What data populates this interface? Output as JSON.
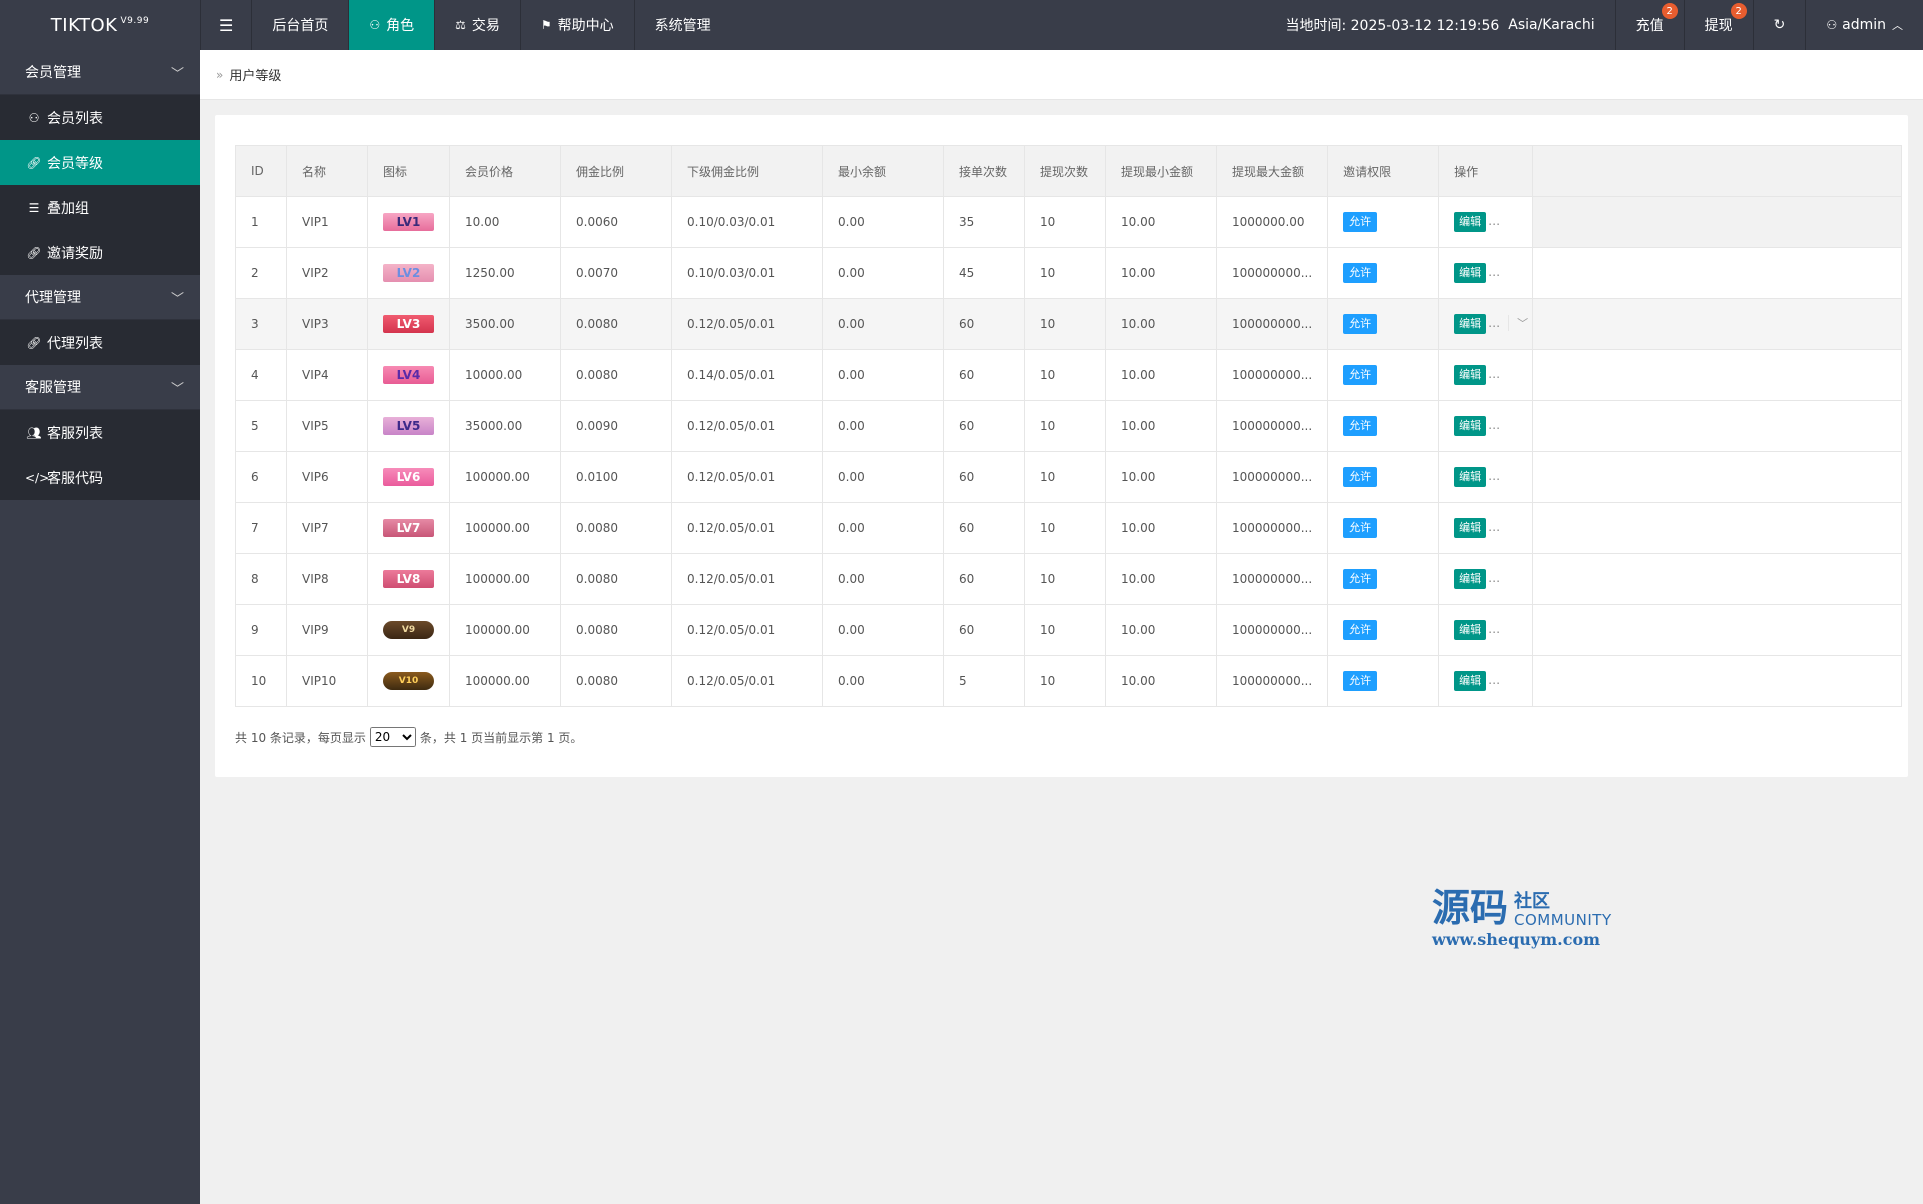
{
  "brand": {
    "name": "TIKTOK",
    "version": "V9.99"
  },
  "topnav": {
    "menu_icon": "menu-icon",
    "items": [
      {
        "label": "后台首页",
        "icon": ""
      },
      {
        "label": "角色",
        "icon": "user-icon",
        "active": true
      },
      {
        "label": "交易",
        "icon": "scale-icon"
      },
      {
        "label": "帮助中心",
        "icon": "flag-icon"
      },
      {
        "label": "系统管理",
        "icon": ""
      }
    ]
  },
  "topright": {
    "time_label": "当地时间: 2025-03-12 12:19:56",
    "timezone": "Asia/Karachi",
    "recharge": {
      "label": "充值",
      "badge": "2"
    },
    "withdraw": {
      "label": "提现",
      "badge": "2"
    },
    "refresh_icon": "refresh-icon",
    "user": {
      "label": "admin"
    }
  },
  "sidebar": {
    "groups": [
      {
        "label": "会员管理",
        "items": [
          {
            "label": "会员列表",
            "icon": "user-icon"
          },
          {
            "label": "会员等级",
            "icon": "link-icon",
            "active": true
          },
          {
            "label": "叠加组",
            "icon": "list-icon"
          },
          {
            "label": "邀请奖励",
            "icon": "link-icon"
          }
        ]
      },
      {
        "label": "代理管理",
        "items": [
          {
            "label": "代理列表",
            "icon": "link-icon"
          }
        ]
      },
      {
        "label": "客服管理",
        "items": [
          {
            "label": "客服列表",
            "icon": "users-icon"
          },
          {
            "label": "客服代码",
            "icon": "code-icon"
          }
        ]
      }
    ]
  },
  "breadcrumb": {
    "current": "用户等级"
  },
  "table": {
    "headers": [
      "ID",
      "名称",
      "图标",
      "会员价格",
      "佣金比例",
      "下级佣金比例",
      "最小余额",
      "接单次数",
      "提现次数",
      "提现最小金额",
      "提现最大金额",
      "邀请权限",
      "操作"
    ],
    "rows": [
      {
        "id": "1",
        "name": "VIP1",
        "icon": "LV1",
        "price": "10.00",
        "rate": "0.0060",
        "sub_rate": "0.10/0.03/0.01",
        "min_balance": "0.00",
        "orders": "35",
        "withdraw_times": "10",
        "wd_min": "10.00",
        "wd_max": "1000000.00",
        "invite": "允许",
        "edit": "编辑"
      },
      {
        "id": "2",
        "name": "VIP2",
        "icon": "LV2",
        "price": "1250.00",
        "rate": "0.0070",
        "sub_rate": "0.10/0.03/0.01",
        "min_balance": "0.00",
        "orders": "45",
        "withdraw_times": "10",
        "wd_min": "10.00",
        "wd_max": "100000000...",
        "invite": "允许",
        "edit": "编辑"
      },
      {
        "id": "3",
        "name": "VIP3",
        "icon": "LV3",
        "price": "3500.00",
        "rate": "0.0080",
        "sub_rate": "0.12/0.05/0.01",
        "min_balance": "0.00",
        "orders": "60",
        "withdraw_times": "10",
        "wd_min": "10.00",
        "wd_max": "100000000...",
        "invite": "允许",
        "edit": "编辑"
      },
      {
        "id": "4",
        "name": "VIP4",
        "icon": "LV4",
        "price": "10000.00",
        "rate": "0.0080",
        "sub_rate": "0.14/0.05/0.01",
        "min_balance": "0.00",
        "orders": "60",
        "withdraw_times": "10",
        "wd_min": "10.00",
        "wd_max": "100000000...",
        "invite": "允许",
        "edit": "编辑"
      },
      {
        "id": "5",
        "name": "VIP5",
        "icon": "LV5",
        "price": "35000.00",
        "rate": "0.0090",
        "sub_rate": "0.12/0.05/0.01",
        "min_balance": "0.00",
        "orders": "60",
        "withdraw_times": "10",
        "wd_min": "10.00",
        "wd_max": "100000000...",
        "invite": "允许",
        "edit": "编辑"
      },
      {
        "id": "6",
        "name": "VIP6",
        "icon": "LV6",
        "price": "100000.00",
        "rate": "0.0100",
        "sub_rate": "0.12/0.05/0.01",
        "min_balance": "0.00",
        "orders": "60",
        "withdraw_times": "10",
        "wd_min": "10.00",
        "wd_max": "100000000...",
        "invite": "允许",
        "edit": "编辑"
      },
      {
        "id": "7",
        "name": "VIP7",
        "icon": "LV7",
        "price": "100000.00",
        "rate": "0.0080",
        "sub_rate": "0.12/0.05/0.01",
        "min_balance": "0.00",
        "orders": "60",
        "withdraw_times": "10",
        "wd_min": "10.00",
        "wd_max": "100000000...",
        "invite": "允许",
        "edit": "编辑"
      },
      {
        "id": "8",
        "name": "VIP8",
        "icon": "LV8",
        "price": "100000.00",
        "rate": "0.0080",
        "sub_rate": "0.12/0.05/0.01",
        "min_balance": "0.00",
        "orders": "60",
        "withdraw_times": "10",
        "wd_min": "10.00",
        "wd_max": "100000000...",
        "invite": "允许",
        "edit": "编辑"
      },
      {
        "id": "9",
        "name": "VIP9",
        "icon": "V9",
        "price": "100000.00",
        "rate": "0.0080",
        "sub_rate": "0.12/0.05/0.01",
        "min_balance": "0.00",
        "orders": "60",
        "withdraw_times": "10",
        "wd_min": "10.00",
        "wd_max": "100000000...",
        "invite": "允许",
        "edit": "编辑"
      },
      {
        "id": "10",
        "name": "VIP10",
        "icon": "V10",
        "price": "100000.00",
        "rate": "0.0080",
        "sub_rate": "0.12/0.05/0.01",
        "min_balance": "0.00",
        "orders": "5",
        "withdraw_times": "10",
        "wd_min": "10.00",
        "wd_max": "100000000...",
        "invite": "允许",
        "edit": "编辑"
      }
    ]
  },
  "pager": {
    "prefix": "共 10 条记录，每页显示",
    "page_size": "20",
    "suffix": "条，共 1 页当前显示第 1 页。"
  },
  "watermark": {
    "big": "源码",
    "small": "社区",
    "community": "COMMUNITY",
    "url": "www.shequym.com"
  }
}
